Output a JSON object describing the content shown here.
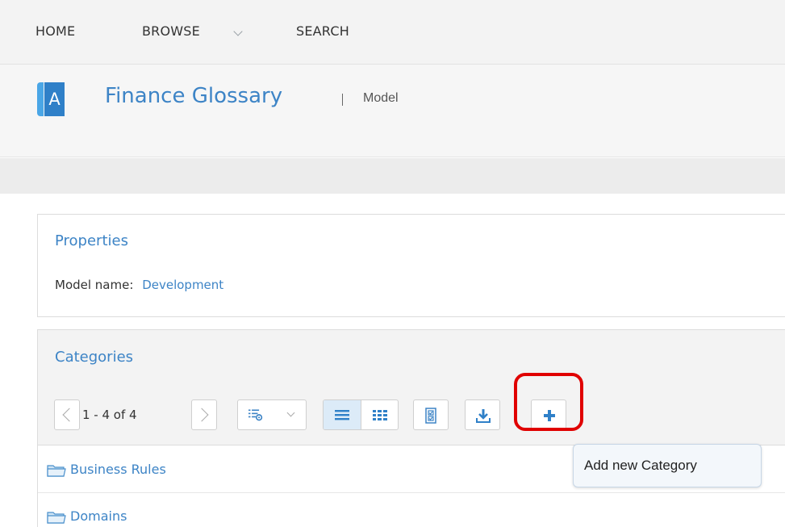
{
  "nav": {
    "home": "HOME",
    "browse": "BROWSE",
    "search": "SEARCH"
  },
  "header": {
    "logo_letter": "A",
    "title": "Finance Glossary",
    "type": "Model"
  },
  "properties": {
    "heading": "Properties",
    "model_name_label": "Model name:",
    "model_name_value": "Development"
  },
  "categories": {
    "heading": "Categories",
    "pager": "1 - 4 of 4",
    "rows": [
      "Business Rules",
      "Domains"
    ],
    "tooltip": "Add new Category"
  },
  "colors": {
    "accent": "#3d84c6",
    "brand": "#2f80c8",
    "highlight": "#e00000"
  }
}
